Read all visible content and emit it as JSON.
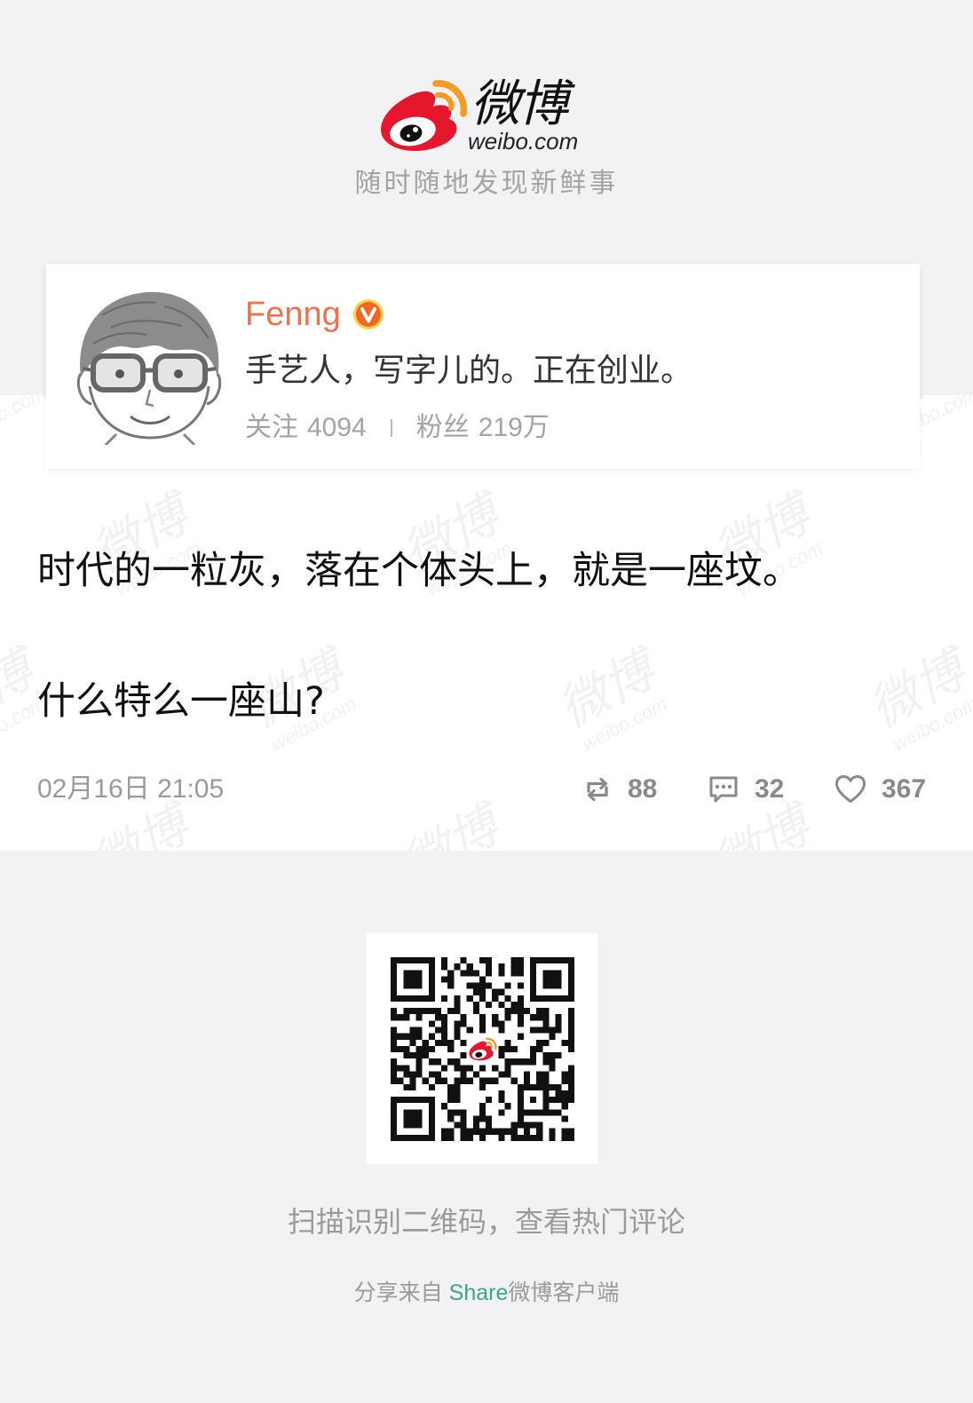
{
  "brand": {
    "logo_text": "微博",
    "logo_subtext": "weibo.com",
    "tagline": "随时随地发现新鲜事",
    "logo_icon": "weibo-logo-icon",
    "logo_red": "#e6162d",
    "logo_orange": "#f59a23"
  },
  "user": {
    "name": "Fenng",
    "name_color": "#eb7350",
    "verified_icon": "verified-badge-icon",
    "bio": "手艺人，写字儿的。正在创业。",
    "following_label": "关注",
    "following_count": "4094",
    "followers_label": "粉丝",
    "followers_count": "219万"
  },
  "post": {
    "paragraphs": [
      "时代的一粒灰，落在个体头上，就是一座坟。",
      "什么特么一座山?"
    ],
    "timestamp": "02月16日 21:05",
    "reposts": "88",
    "comments": "32",
    "likes": "367",
    "icons": {
      "repost": "repost-icon",
      "comment": "comment-icon",
      "like": "heart-icon"
    }
  },
  "qr": {
    "caption": "扫描识别二维码，查看热门评论"
  },
  "share": {
    "prefix": "分享来自",
    "app_highlight": "Share",
    "app_suffix": "微博客户端",
    "highlight_color": "#3aa58a"
  },
  "watermark": {
    "text": "微博",
    "subtext": "weibo.com"
  },
  "colors": {
    "page_background": "#f2f2f4",
    "muted_text": "#9a9a9a",
    "body_text": "#111111"
  }
}
